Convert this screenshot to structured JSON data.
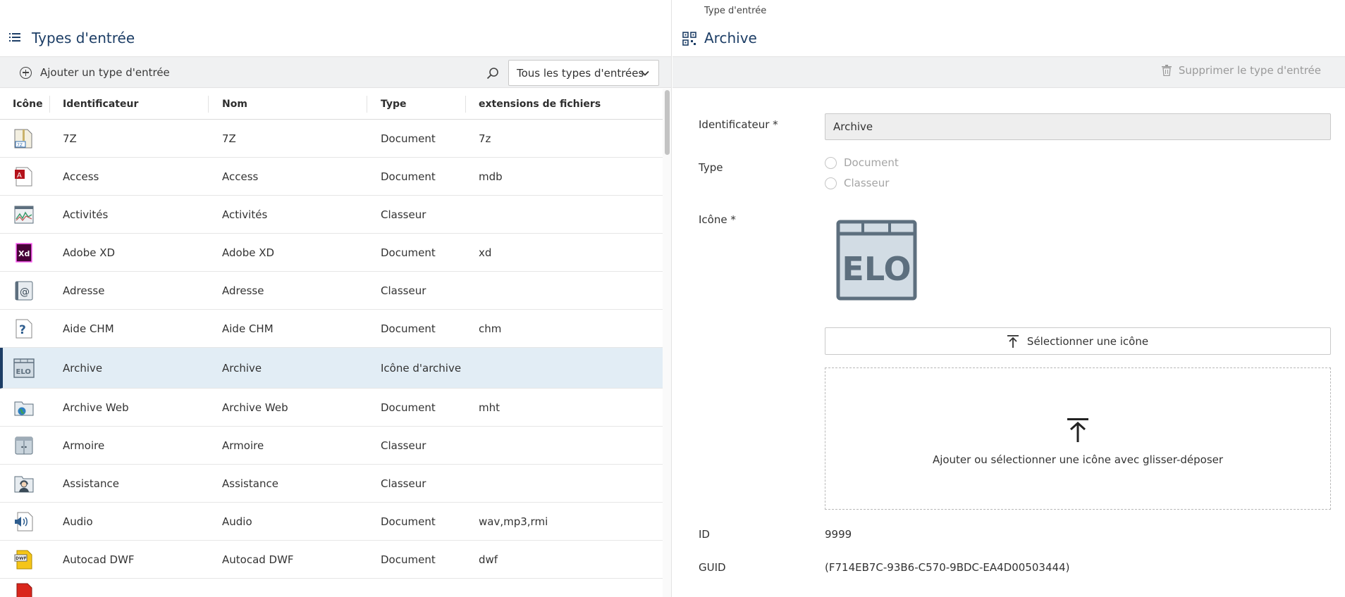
{
  "left": {
    "title": "Types d'entrée",
    "add_label": "Ajouter un type d'entrée",
    "filter_value": "Tous les types d'entrées",
    "columns": [
      "Icône",
      "Identificateur",
      "Nom",
      "Type",
      "extensions de fichiers"
    ],
    "rows": [
      {
        "icon": "7z-archive-icon",
        "identifier": "7Z",
        "name": "7Z",
        "type": "Document",
        "ext": "7z"
      },
      {
        "icon": "access-icon",
        "identifier": "Access",
        "name": "Access",
        "type": "Document",
        "ext": "mdb"
      },
      {
        "icon": "activities-icon",
        "identifier": "Activités",
        "name": "Activités",
        "type": "Classeur",
        "ext": ""
      },
      {
        "icon": "adobe-xd-icon",
        "identifier": "Adobe XD",
        "name": "Adobe XD",
        "type": "Document",
        "ext": "xd"
      },
      {
        "icon": "address-icon",
        "identifier": "Adresse",
        "name": "Adresse",
        "type": "Classeur",
        "ext": ""
      },
      {
        "icon": "help-chm-icon",
        "identifier": "Aide CHM",
        "name": "Aide CHM",
        "type": "Document",
        "ext": "chm"
      },
      {
        "icon": "elo-archive-icon",
        "identifier": "Archive",
        "name": "Archive",
        "type": "Icône d'archive",
        "ext": "",
        "selected": true
      },
      {
        "icon": "web-archive-icon",
        "identifier": "Archive Web",
        "name": "Archive Web",
        "type": "Document",
        "ext": "mht"
      },
      {
        "icon": "cabinet-icon",
        "identifier": "Armoire",
        "name": "Armoire",
        "type": "Classeur",
        "ext": ""
      },
      {
        "icon": "assistance-icon",
        "identifier": "Assistance",
        "name": "Assistance",
        "type": "Classeur",
        "ext": ""
      },
      {
        "icon": "audio-icon",
        "identifier": "Audio",
        "name": "Audio",
        "type": "Document",
        "ext": "wav,mp3,rmi"
      },
      {
        "icon": "autocad-dwf-icon",
        "identifier": "Autocad DWF",
        "name": "Autocad DWF",
        "type": "Document",
        "ext": "dwf"
      }
    ]
  },
  "right": {
    "breadcrumb": "Type d'entrée",
    "title": "Archive",
    "delete_label": "Supprimer le type d'entrée",
    "identifier_label": "Identificateur *",
    "identifier_value": "Archive",
    "type_label": "Type",
    "type_options": [
      "Document",
      "Classeur"
    ],
    "icon_label": "Icône *",
    "preview_text": "ELO",
    "select_icon_label": "Sélectionner une icône",
    "dropzone_text": "Ajouter ou sélectionner une icône avec glisser-déposer",
    "id_label": "ID",
    "id_value": "9999",
    "guid_label": "GUID",
    "guid_value": "(F714EB7C-93B6-C570-9BDC-EA4D00503444)"
  },
  "colors": {
    "accent": "#1d3e66",
    "selected_row": "#e2edf5",
    "toolbar_bg": "#f0f1f2"
  }
}
